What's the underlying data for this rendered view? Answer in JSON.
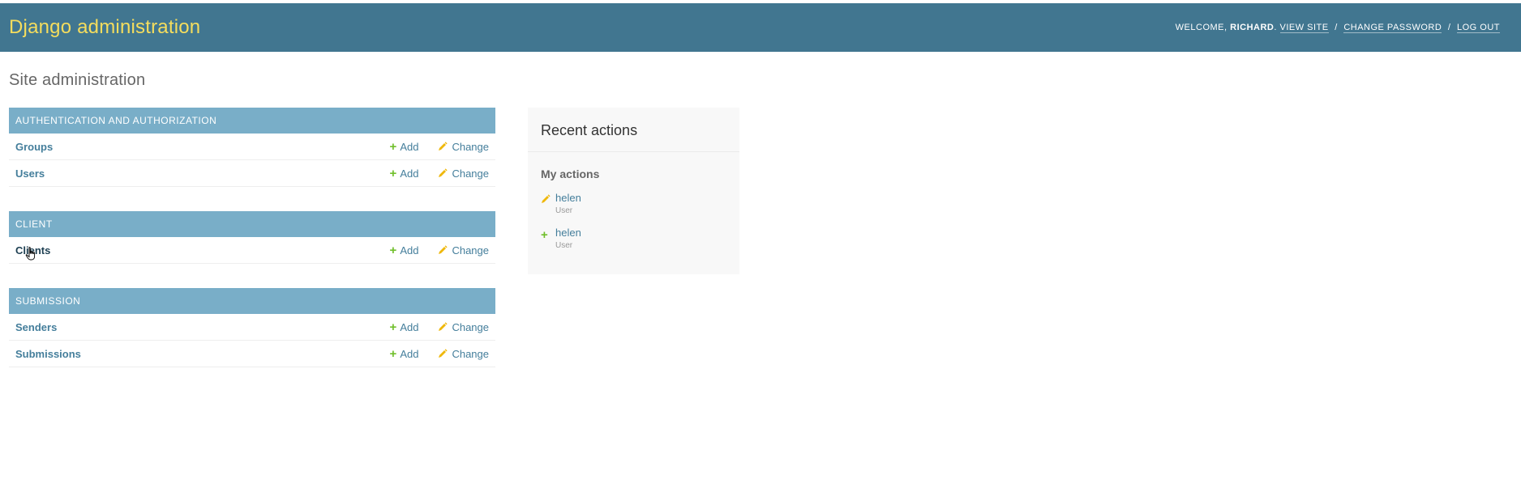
{
  "header": {
    "branding": "Django administration",
    "welcome": "Welcome,",
    "username": "Richard",
    "links": [
      {
        "label": "View site"
      },
      {
        "label": "Change password"
      },
      {
        "label": "Log out"
      }
    ]
  },
  "page": {
    "title": "Site administration"
  },
  "modules": [
    {
      "caption": "Authentication and Authorization",
      "rows": [
        {
          "name": "Groups",
          "add": "Add",
          "change": "Change"
        },
        {
          "name": "Users",
          "add": "Add",
          "change": "Change"
        }
      ]
    },
    {
      "caption": "Client",
      "rows": [
        {
          "name": "Clients",
          "add": "Add",
          "change": "Change"
        }
      ]
    },
    {
      "caption": "Submission",
      "rows": [
        {
          "name": "Senders",
          "add": "Add",
          "change": "Change"
        },
        {
          "name": "Submissions",
          "add": "Add",
          "change": "Change"
        }
      ]
    }
  ],
  "recent": {
    "title": "Recent actions",
    "subtitle": "My actions",
    "items": [
      {
        "icon": "pencil-icon",
        "name": "helen",
        "type": "User"
      },
      {
        "icon": "plus-icon",
        "name": "helen",
        "type": "User"
      }
    ]
  },
  "colors": {
    "header_bg": "#417690",
    "branding": "#f5dd5d",
    "module_caption_bg": "#79aec8",
    "link": "#447e9b",
    "add_icon": "#70bf2b",
    "change_icon": "#efb80b"
  }
}
